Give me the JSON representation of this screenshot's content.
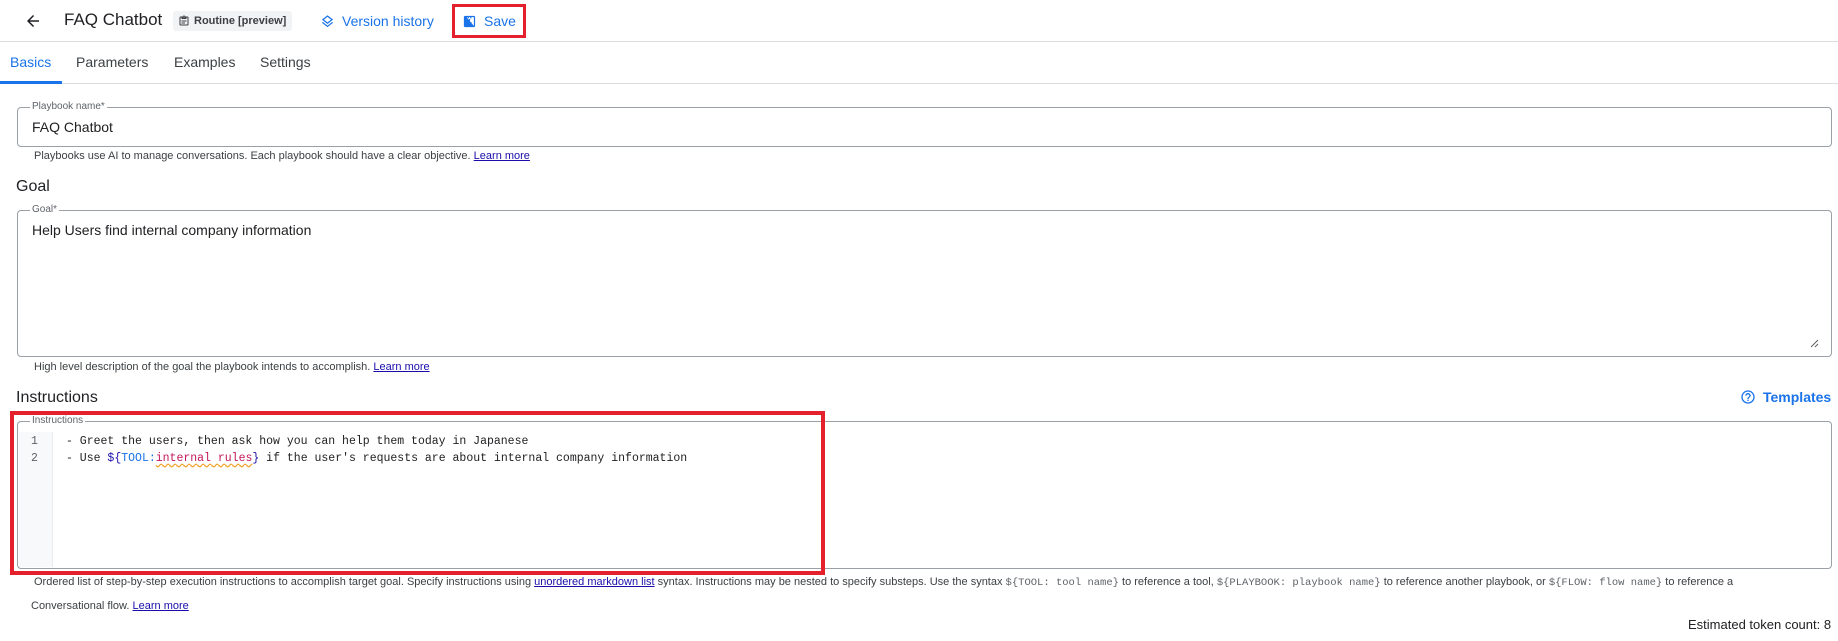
{
  "header": {
    "title": "FAQ Chatbot",
    "badge_label": "Routine [preview]",
    "version_history_label": "Version history",
    "save_label": "Save"
  },
  "tabs": [
    {
      "label": "Basics",
      "active": true
    },
    {
      "label": "Parameters",
      "active": false
    },
    {
      "label": "Examples",
      "active": false
    },
    {
      "label": "Settings",
      "active": false
    }
  ],
  "playbook_name": {
    "label": "Playbook name*",
    "value": "FAQ Chatbot",
    "hint": "Playbooks use AI to manage conversations. Each playbook should have a clear objective.",
    "learn_more": "Learn more"
  },
  "goal": {
    "section_title": "Goal",
    "label": "Goal*",
    "value": "Help Users find internal company information",
    "hint": "High level description of the goal the playbook intends to accomplish.",
    "learn_more": "Learn more"
  },
  "instructions": {
    "section_title": "Instructions",
    "templates_label": "Templates",
    "label": "Instructions",
    "lines": [
      {
        "number": "1",
        "text": "- Greet the users, then ask how you can help them today in Japanese"
      },
      {
        "number": "2",
        "prefix": "- Use ",
        "brace_open": "${",
        "tool_kw": "TOOL:",
        "tool_name": "internal rules",
        "brace_close": "}",
        "suffix": " if the user's requests are about internal company information"
      }
    ],
    "hint": {
      "part1": "Ordered list of step-by-step execution instructions to accomplish target goal. Specify instructions using ",
      "link1": "unordered markdown list",
      "part2": " syntax. Instructions may be nested to specify substeps. Use the syntax ",
      "code1": "${TOOL: tool name}",
      "part3": " to reference a tool, ",
      "code2": "${PLAYBOOK: playbook name}",
      "part4": " to reference another playbook, or ",
      "code3": "${FLOW: flow name}",
      "part5": " to reference a",
      "line2": "Conversational flow.",
      "learn_more": "Learn more"
    }
  },
  "token_count_label": "Estimated token count: 8",
  "colors": {
    "accent": "#1a73e8",
    "highlight_box": "#e3202b",
    "border": "#9aa0a6"
  }
}
